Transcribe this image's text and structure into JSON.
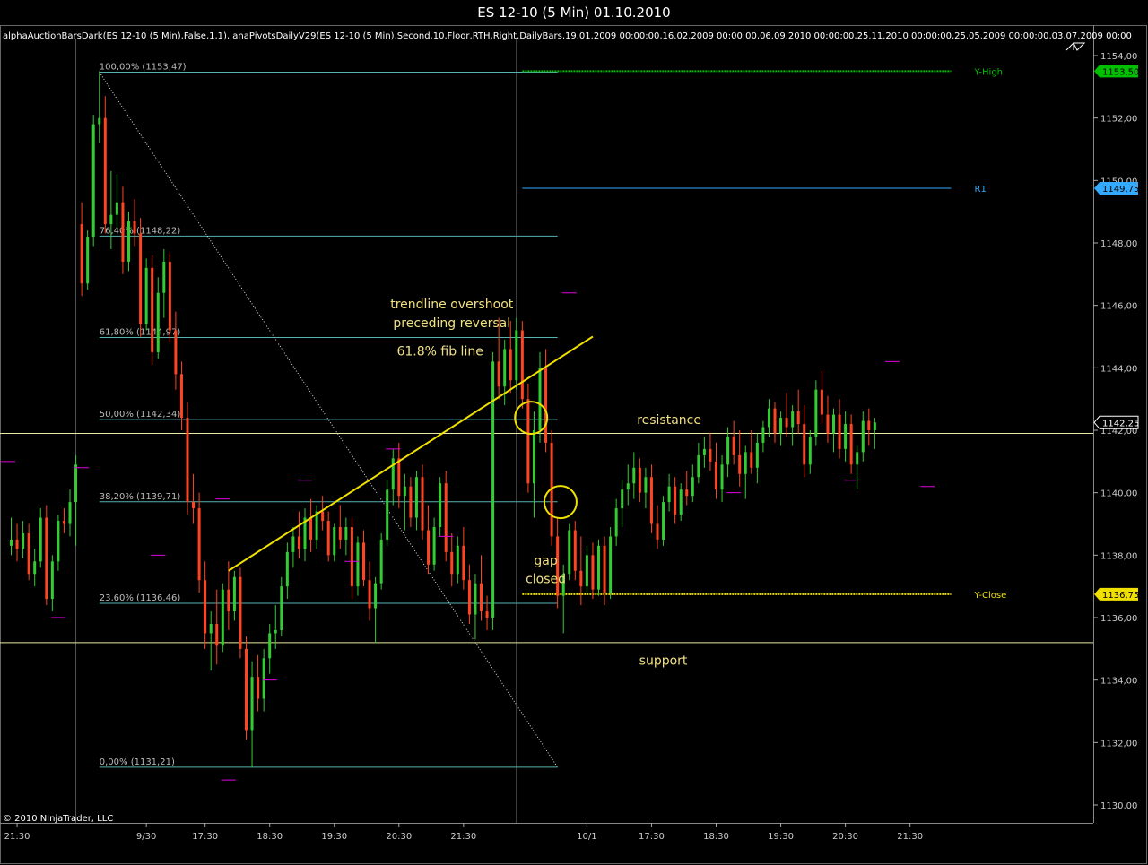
{
  "window": {
    "title": "ES 12-10 (5 Min)  01.10.2010"
  },
  "indicator_line": "alphaAuctionBarsDark(ES 12-10 (5 Min),False,1,1), anaPivotsDailyV29(ES 12-10 (5 Min),Second,10,Floor,RTH,Right,DailyBars,19.01.2009 00:00:00,16.02.2009  00:00:00,06.09.2010 00:00:00,25.11.2010 00:00:00,25.05.2009 00:00:00,03.07.2009 00:00",
  "copyright": "© 2010 NinjaTrader, LLC",
  "colors": {
    "up": "#33cc33",
    "down": "#ff4422",
    "fib": "#55b3b3",
    "yellow": "#f0e000",
    "pivot_high": "#00c000",
    "pivot_r1": "#33aaff",
    "magenta": "#e000e0"
  },
  "chart_data": {
    "type": "candlestick",
    "title": "ES 12-10 (5 Min)  01.10.2010",
    "ylim": [
      1129.0,
      1155.0
    ],
    "grid": false,
    "y_ticks": [
      "1154,00",
      "1152,00",
      "1150,00",
      "1148,00",
      "1146,00",
      "1144,00",
      "1142,00",
      "1140,00",
      "1138,00",
      "1136,00",
      "1134,00",
      "1132,00",
      "1130,00"
    ],
    "x_ticks": [
      {
        "label": "21:30",
        "bar": 1
      },
      {
        "label": "9/30",
        "bar": 23
      },
      {
        "label": "17:30",
        "bar": 33
      },
      {
        "label": "18:30",
        "bar": 44
      },
      {
        "label": "19:30",
        "bar": 55
      },
      {
        "label": "20:30",
        "bar": 66
      },
      {
        "label": "21:30",
        "bar": 77
      },
      {
        "label": "10/1",
        "bar": 98
      },
      {
        "label": "17:30",
        "bar": 109
      },
      {
        "label": "18:30",
        "bar": 120
      },
      {
        "label": "19:30",
        "bar": 131
      },
      {
        "label": "20:30",
        "bar": 142
      },
      {
        "label": "21:30",
        "bar": 153
      }
    ],
    "price_labels": [
      {
        "text": "1153,50",
        "value": 1153.5,
        "color": "#00c000"
      },
      {
        "text": "1149,75",
        "value": 1149.75,
        "color": "#33aaff"
      },
      {
        "text": "1142,25",
        "value": 1142.25,
        "color": "#000000"
      },
      {
        "text": "1136,75",
        "value": 1136.75,
        "color": "#f0e000"
      }
    ],
    "fib_levels": [
      {
        "label": "100,00% (1153,47)",
        "value": 1153.47
      },
      {
        "label": "76,40% (1148,22)",
        "value": 1148.22
      },
      {
        "label": "61,80% (1144,97)",
        "value": 1144.97
      },
      {
        "label": "50,00% (1142,34)",
        "value": 1142.34
      },
      {
        "label": "38,20% (1139,71)",
        "value": 1139.71
      },
      {
        "label": "23,60% (1136,46)",
        "value": 1136.46
      },
      {
        "label": "0,00% (1131,21)",
        "value": 1131.21
      }
    ],
    "fib_range": {
      "bar_start": 15,
      "bar_end": 93
    },
    "pivot_lines": [
      {
        "name": "Y-High",
        "value": 1153.5,
        "bar_start": 87,
        "bar_end": 160,
        "style": "dotted"
      },
      {
        "name": "R1",
        "value": 1149.75,
        "bar_start": 87,
        "bar_end": 160,
        "style": "solid"
      },
      {
        "name": "Y-Close",
        "value": 1136.75,
        "bar_start": 87,
        "bar_end": 160,
        "style": "dotted"
      }
    ],
    "horizontal_lines": [
      {
        "name": "resistance",
        "value": 1141.9
      },
      {
        "name": "support",
        "value": 1135.2
      }
    ],
    "trendline": {
      "from": {
        "bar": 37,
        "price": 1137.5
      },
      "to": {
        "bar": 99,
        "price": 1145.0
      }
    },
    "diagonal": {
      "from": {
        "bar": 15,
        "price": 1153.47
      },
      "to": {
        "bar": 93,
        "price": 1131.21
      }
    },
    "vertical_lines": [
      {
        "bar": 11
      },
      {
        "bar": 86
      }
    ],
    "annotations": [
      {
        "text": "trendline overshoot",
        "bar": 75,
        "price": 1145.9
      },
      {
        "text": "preceding reversal",
        "bar": 75,
        "price": 1145.3
      },
      {
        "text": "61.8% fib line",
        "bar": 73,
        "price": 1144.4
      },
      {
        "text": "resistance",
        "bar": 112,
        "price": 1142.2
      },
      {
        "text": "gap",
        "bar": 91,
        "price": 1137.7
      },
      {
        "text": "closed",
        "bar": 91,
        "price": 1137.1
      },
      {
        "text": "support",
        "bar": 111,
        "price": 1134.5
      }
    ],
    "circles": [
      {
        "bar": 88.5,
        "price": 1142.4
      },
      {
        "bar": 93.5,
        "price": 1139.7
      }
    ],
    "candles": [
      [
        1138.3,
        1139.2,
        1138.0,
        1138.5
      ],
      [
        1138.5,
        1139.0,
        1137.8,
        1138.2
      ],
      [
        1138.2,
        1139.1,
        1137.9,
        1138.7
      ],
      [
        1138.7,
        1139.0,
        1137.2,
        1137.4
      ],
      [
        1137.4,
        1138.2,
        1137.0,
        1137.8
      ],
      [
        1137.8,
        1139.5,
        1137.6,
        1139.2
      ],
      [
        1139.2,
        1139.6,
        1136.4,
        1136.6
      ],
      [
        1136.6,
        1138.0,
        1136.2,
        1137.8
      ],
      [
        1137.8,
        1139.3,
        1137.5,
        1139.1
      ],
      [
        1139.1,
        1139.5,
        1138.7,
        1139.0
      ],
      [
        1139.0,
        1140.1,
        1138.6,
        1139.7
      ],
      [
        1139.7,
        1141.2,
        1138.3,
        1140.9
      ],
      [
        1148.6,
        1149.3,
        1146.3,
        1146.7
      ],
      [
        1146.7,
        1148.4,
        1146.5,
        1148.2
      ],
      [
        1148.2,
        1152.1,
        1147.9,
        1151.8
      ],
      [
        1151.8,
        1153.5,
        1151.2,
        1152.0
      ],
      [
        1152.0,
        1152.7,
        1148.3,
        1148.6
      ],
      [
        1148.6,
        1150.3,
        1147.8,
        1148.9
      ],
      [
        1148.9,
        1150.2,
        1148.5,
        1149.3
      ],
      [
        1149.3,
        1149.8,
        1147.0,
        1147.4
      ],
      [
        1147.4,
        1149.0,
        1147.1,
        1148.7
      ],
      [
        1148.7,
        1149.4,
        1147.9,
        1148.3
      ],
      [
        1148.3,
        1148.8,
        1145.0,
        1145.4
      ],
      [
        1145.4,
        1147.5,
        1145.2,
        1147.2
      ],
      [
        1147.2,
        1147.6,
        1144.1,
        1144.5
      ],
      [
        1144.5,
        1146.9,
        1144.3,
        1146.4
      ],
      [
        1146.4,
        1147.8,
        1145.6,
        1147.4
      ],
      [
        1147.4,
        1147.7,
        1144.8,
        1145.2
      ],
      [
        1145.2,
        1145.8,
        1143.3,
        1143.8
      ],
      [
        1143.8,
        1144.2,
        1142.0,
        1142.4
      ],
      [
        1142.4,
        1142.9,
        1139.3,
        1139.7
      ],
      [
        1139.7,
        1140.6,
        1139.0,
        1139.5
      ],
      [
        1139.5,
        1140.0,
        1136.8,
        1137.2
      ],
      [
        1137.2,
        1137.8,
        1135.0,
        1135.5
      ],
      [
        1135.5,
        1136.2,
        1134.3,
        1135.8
      ],
      [
        1135.8,
        1136.9,
        1134.5,
        1135.1
      ],
      [
        1135.1,
        1137.1,
        1134.9,
        1136.9
      ],
      [
        1136.9,
        1137.8,
        1135.6,
        1136.2
      ],
      [
        1136.2,
        1137.5,
        1135.9,
        1137.3
      ],
      [
        1137.3,
        1137.6,
        1134.7,
        1135.0
      ],
      [
        1135.0,
        1135.4,
        1132.1,
        1132.4
      ],
      [
        1132.4,
        1134.6,
        1131.2,
        1134.1
      ],
      [
        1134.1,
        1134.8,
        1133.0,
        1133.4
      ],
      [
        1133.4,
        1135.0,
        1133.0,
        1134.7
      ],
      [
        1134.7,
        1135.8,
        1134.2,
        1135.5
      ],
      [
        1135.5,
        1136.4,
        1135.0,
        1135.6
      ],
      [
        1135.6,
        1137.3,
        1135.4,
        1137.0
      ],
      [
        1137.0,
        1138.4,
        1136.6,
        1138.1
      ],
      [
        1138.1,
        1138.9,
        1137.6,
        1138.6
      ],
      [
        1138.6,
        1139.4,
        1137.9,
        1138.2
      ],
      [
        1138.2,
        1139.5,
        1137.8,
        1139.2
      ],
      [
        1139.2,
        1139.8,
        1138.1,
        1138.5
      ],
      [
        1138.5,
        1139.6,
        1138.2,
        1139.4
      ],
      [
        1139.4,
        1139.9,
        1138.8,
        1139.1
      ],
      [
        1139.1,
        1139.4,
        1137.8,
        1138.0
      ],
      [
        1138.0,
        1139.0,
        1137.8,
        1138.9
      ],
      [
        1138.9,
        1139.6,
        1138.2,
        1138.5
      ],
      [
        1138.5,
        1139.2,
        1138.0,
        1138.9
      ],
      [
        1138.9,
        1139.2,
        1136.6,
        1137.0
      ],
      [
        1137.0,
        1138.6,
        1136.7,
        1138.4
      ],
      [
        1138.4,
        1138.8,
        1137.0,
        1137.2
      ],
      [
        1137.2,
        1137.8,
        1135.9,
        1136.3
      ],
      [
        1136.3,
        1137.3,
        1135.2,
        1137.1
      ],
      [
        1137.1,
        1138.7,
        1136.9,
        1138.5
      ],
      [
        1138.5,
        1140.4,
        1138.3,
        1140.1
      ],
      [
        1140.1,
        1141.4,
        1139.6,
        1141.1
      ],
      [
        1141.1,
        1141.6,
        1139.5,
        1139.9
      ],
      [
        1139.9,
        1140.6,
        1138.8,
        1140.2
      ],
      [
        1140.2,
        1140.5,
        1138.9,
        1139.2
      ],
      [
        1139.2,
        1140.7,
        1138.8,
        1140.5
      ],
      [
        1140.5,
        1140.9,
        1138.5,
        1138.8
      ],
      [
        1138.8,
        1139.6,
        1137.4,
        1137.7
      ],
      [
        1137.7,
        1139.2,
        1137.5,
        1138.9
      ],
      [
        1138.9,
        1140.5,
        1138.6,
        1140.3
      ],
      [
        1140.3,
        1140.7,
        1137.8,
        1138.1
      ],
      [
        1138.1,
        1138.7,
        1137.0,
        1137.4
      ],
      [
        1137.4,
        1138.6,
        1137.1,
        1138.3
      ],
      [
        1138.3,
        1138.9,
        1136.9,
        1137.2
      ],
      [
        1137.2,
        1137.7,
        1135.8,
        1136.1
      ],
      [
        1136.1,
        1137.4,
        1135.3,
        1137.1
      ],
      [
        1137.1,
        1138.0,
        1135.9,
        1136.2
      ],
      [
        1136.2,
        1136.7,
        1135.6,
        1136.0
      ],
      [
        1136.0,
        1144.5,
        1135.6,
        1144.2
      ],
      [
        1144.2,
        1145.6,
        1143.0,
        1143.4
      ],
      [
        1143.4,
        1144.9,
        1142.8,
        1144.6
      ],
      [
        1144.6,
        1145.5,
        1143.2,
        1143.6
      ],
      [
        1143.6,
        1145.6,
        1143.3,
        1145.2
      ],
      [
        1145.2,
        1145.5,
        1142.7,
        1143.0
      ],
      [
        1143.0,
        1143.5,
        1140.0,
        1140.3
      ],
      [
        1140.3,
        1142.6,
        1139.2,
        1142.0
      ],
      [
        1142.0,
        1144.5,
        1141.6,
        1144.0
      ],
      [
        1144.0,
        1144.6,
        1141.3,
        1141.6
      ],
      [
        1141.6,
        1142.0,
        1138.3,
        1138.6
      ],
      [
        1138.6,
        1139.2,
        1136.3,
        1136.7
      ],
      [
        1136.7,
        1137.7,
        1135.5,
        1137.4
      ],
      [
        1137.4,
        1139.0,
        1137.2,
        1138.8
      ],
      [
        1138.8,
        1139.1,
        1137.2,
        1137.5
      ],
      [
        1137.5,
        1138.6,
        1136.4,
        1137.0
      ],
      [
        1137.0,
        1138.3,
        1136.8,
        1138.0
      ],
      [
        1138.0,
        1138.4,
        1136.6,
        1136.9
      ],
      [
        1136.9,
        1138.5,
        1136.7,
        1138.3
      ],
      [
        1138.3,
        1138.6,
        1136.4,
        1136.8
      ],
      [
        1136.8,
        1138.9,
        1136.6,
        1138.6
      ],
      [
        1138.6,
        1139.8,
        1138.3,
        1139.5
      ],
      [
        1139.5,
        1140.4,
        1138.9,
        1140.1
      ],
      [
        1140.1,
        1140.9,
        1139.6,
        1140.3
      ],
      [
        1140.3,
        1141.3,
        1139.8,
        1140.8
      ],
      [
        1140.8,
        1141.1,
        1139.7,
        1140.0
      ],
      [
        1140.0,
        1140.8,
        1139.5,
        1140.5
      ],
      [
        1140.5,
        1140.9,
        1138.7,
        1139.0
      ],
      [
        1139.0,
        1139.6,
        1138.2,
        1138.5
      ],
      [
        1138.5,
        1139.9,
        1138.3,
        1139.7
      ],
      [
        1139.7,
        1140.6,
        1139.4,
        1140.2
      ],
      [
        1140.2,
        1140.5,
        1139.0,
        1139.3
      ],
      [
        1139.3,
        1140.3,
        1139.1,
        1140.1
      ],
      [
        1140.1,
        1140.7,
        1139.6,
        1139.9
      ],
      [
        1139.9,
        1140.9,
        1139.7,
        1140.5
      ],
      [
        1140.5,
        1141.6,
        1140.3,
        1141.2
      ],
      [
        1141.2,
        1141.8,
        1140.8,
        1141.4
      ],
      [
        1141.4,
        1141.9,
        1140.7,
        1141.0
      ],
      [
        1141.0,
        1141.6,
        1139.8,
        1140.1
      ],
      [
        1140.1,
        1141.2,
        1139.7,
        1140.9
      ],
      [
        1140.9,
        1142.1,
        1140.5,
        1141.8
      ],
      [
        1141.8,
        1142.3,
        1140.9,
        1141.2
      ],
      [
        1141.2,
        1142.0,
        1140.2,
        1140.6
      ],
      [
        1140.6,
        1141.5,
        1139.8,
        1141.3
      ],
      [
        1141.3,
        1142.0,
        1140.6,
        1140.8
      ],
      [
        1140.8,
        1141.9,
        1140.3,
        1141.6
      ],
      [
        1141.6,
        1142.3,
        1141.3,
        1142.1
      ],
      [
        1142.1,
        1143.0,
        1141.8,
        1142.7
      ],
      [
        1142.7,
        1142.9,
        1141.6,
        1141.9
      ],
      [
        1141.9,
        1142.6,
        1141.5,
        1142.4
      ],
      [
        1142.4,
        1143.2,
        1141.8,
        1142.1
      ],
      [
        1142.1,
        1142.8,
        1141.5,
        1142.6
      ],
      [
        1142.6,
        1143.3,
        1141.9,
        1142.2
      ],
      [
        1142.2,
        1142.8,
        1140.5,
        1140.9
      ],
      [
        1140.9,
        1142.0,
        1140.6,
        1141.8
      ],
      [
        1141.8,
        1143.6,
        1141.5,
        1143.3
      ],
      [
        1143.3,
        1143.9,
        1142.2,
        1142.5
      ],
      [
        1142.5,
        1143.1,
        1141.6,
        1141.9
      ],
      [
        1141.9,
        1142.7,
        1141.3,
        1142.5
      ],
      [
        1142.5,
        1143.0,
        1141.1,
        1141.4
      ],
      [
        1141.4,
        1142.6,
        1141.0,
        1142.2
      ],
      [
        1142.2,
        1142.5,
        1140.6,
        1140.9
      ],
      [
        1140.9,
        1141.5,
        1140.1,
        1141.3
      ],
      [
        1141.3,
        1142.6,
        1141.0,
        1142.3
      ],
      [
        1142.3,
        1142.7,
        1141.5,
        1142.0
      ],
      [
        1142.0,
        1142.4,
        1141.4,
        1142.25
      ]
    ]
  }
}
